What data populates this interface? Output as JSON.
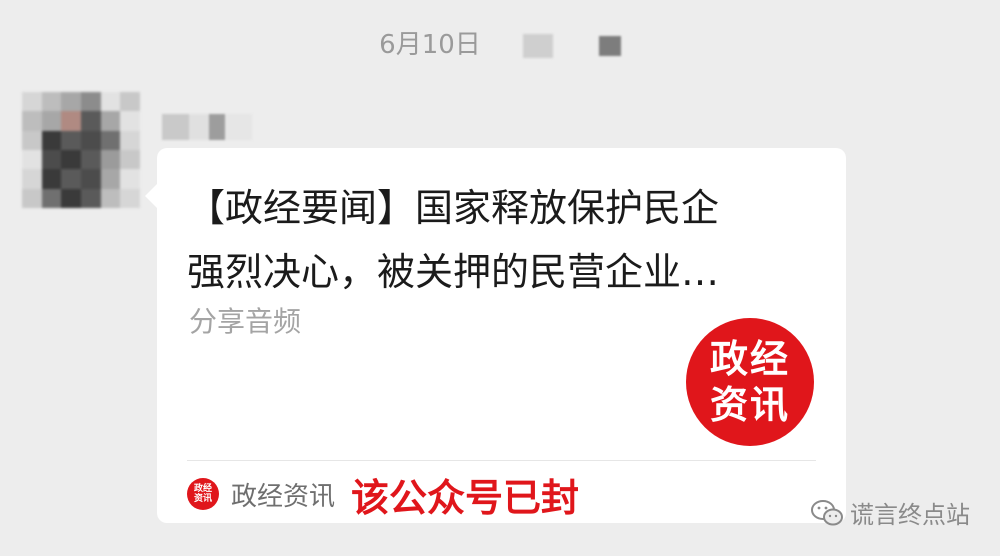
{
  "timestamp": "6月10日",
  "message": {
    "title_lines": [
      "【政经要闻】国家释放保护民企",
      "强烈决心，被关押的民营企业…"
    ],
    "share_label": "分享音频",
    "logo_text_top": "政经",
    "logo_text_bottom": "资讯",
    "footer": {
      "small_logo_top": "政经",
      "small_logo_bottom": "资讯",
      "account_name": "政经资讯",
      "blocked_note": "该公众号已封"
    }
  },
  "watermark": {
    "icon": "wechat-icon",
    "text": "谎言终点站"
  },
  "colors": {
    "background": "#ededed",
    "bubble": "#ffffff",
    "brand_red": "#e0161b"
  }
}
